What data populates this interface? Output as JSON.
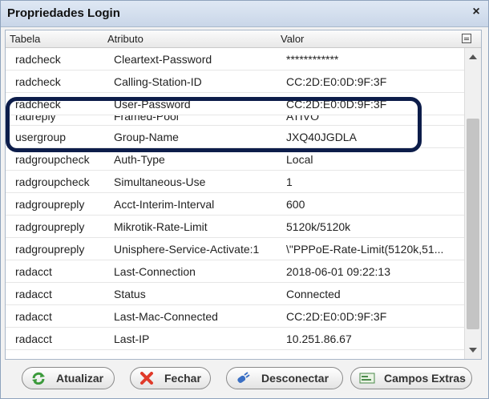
{
  "window": {
    "title": "Propriedades Login",
    "close_glyph": "×"
  },
  "table": {
    "headers": [
      "Tabela",
      "Atributo",
      "Valor"
    ],
    "partial_row": {
      "tabela": "radreply",
      "atributo": "Framed-Pool",
      "valor": "ATIVO"
    },
    "rows": [
      {
        "tabela": "radcheck",
        "atributo": "Cleartext-Password",
        "valor": "************"
      },
      {
        "tabela": "radcheck",
        "atributo": "Calling-Station-ID",
        "valor": "CC:2D:E0:0D:9F:3F"
      },
      {
        "tabela": "radcheck",
        "atributo": "User-Password",
        "valor": "CC:2D:E0:0D:9F:3F"
      },
      {
        "tabela": "usergroup",
        "atributo": "Group-Name",
        "valor": "JXQ40JGDLA"
      },
      {
        "tabela": "radgroupcheck",
        "atributo": "Auth-Type",
        "valor": "Local"
      },
      {
        "tabela": "radgroupcheck",
        "atributo": "Simultaneous-Use",
        "valor": "1"
      },
      {
        "tabela": "radgroupreply",
        "atributo": "Acct-Interim-Interval",
        "valor": "600"
      },
      {
        "tabela": "radgroupreply",
        "atributo": "Mikrotik-Rate-Limit",
        "valor": "5120k/5120k"
      },
      {
        "tabela": "radgroupreply",
        "atributo": "Unisphere-Service-Activate:1",
        "valor": "\\\"PPPoE-Rate-Limit(5120k,51..."
      },
      {
        "tabela": "radacct",
        "atributo": "Last-Connection",
        "valor": "2018-06-01 09:22:13"
      },
      {
        "tabela": "radacct",
        "atributo": "Status",
        "valor": "Connected"
      },
      {
        "tabela": "radacct",
        "atributo": "Last-Mac-Connected",
        "valor": "CC:2D:E0:0D:9F:3F"
      },
      {
        "tabela": "radacct",
        "atributo": "Last-IP",
        "valor": "10.251.86.67"
      }
    ]
  },
  "buttons": {
    "refresh": {
      "label": "Atualizar",
      "icon": "refresh-icon"
    },
    "close": {
      "label": "Fechar",
      "icon": "close-x-icon"
    },
    "disconnect": {
      "label": "Desconectar",
      "icon": "plug-icon"
    },
    "extra_fields": {
      "label": "Campos Extras",
      "icon": "form-icon"
    }
  },
  "colors": {
    "highlight_border": "#0d1d4a",
    "title_bg": "#c9d6e8"
  }
}
